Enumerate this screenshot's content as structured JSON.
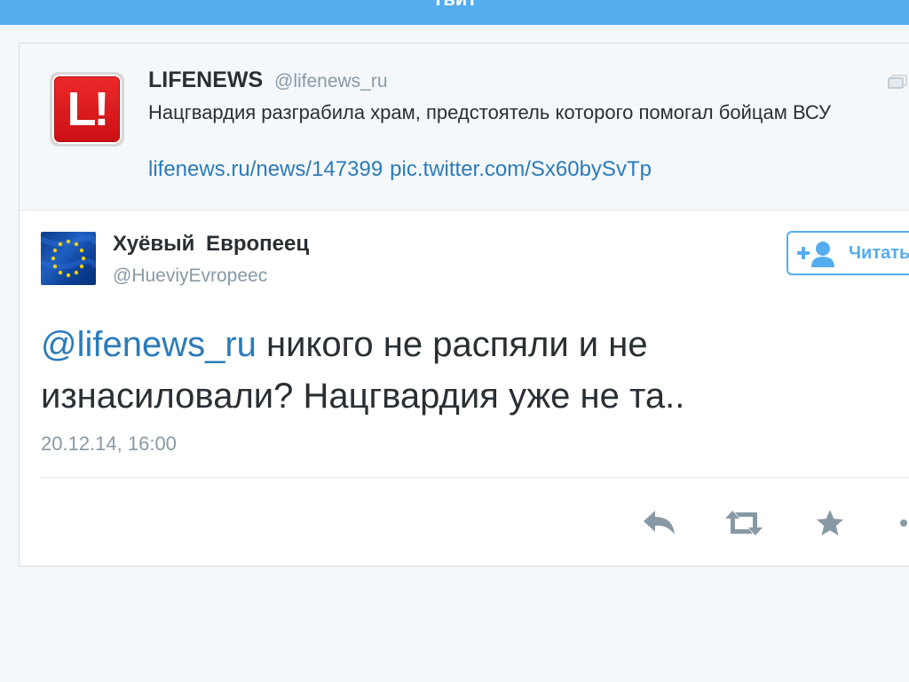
{
  "top_bar": {
    "title": "Твит"
  },
  "quoted_tweet": {
    "logo_text": "L!",
    "author_name": "LIFENEWS",
    "author_handle": "@lifenews_ru",
    "text": "Нацгвардия разграбила храм, предстоятель которого помогал бойцам ВСУ",
    "link": "lifenews.ru/news/147399",
    "media_link": "pic.twitter.com/Sx60bySvTp",
    "icon": "gallery-icon"
  },
  "tweet": {
    "author_name": "Хуёвый Европеец",
    "author_handle": "@HueviyEvropeec",
    "avatar": "eu-flag-avatar",
    "follow_label": "Читать",
    "mention": "@lifenews_ru",
    "text": " никого не распяли и не изнасиловали? Нацгвардия уже не та..",
    "timestamp": "20.12.14, 16:00"
  },
  "actions": [
    "reply-icon",
    "retweet-icon",
    "favorite-icon",
    "more-icon"
  ],
  "colors": {
    "accent": "#55acee",
    "link": "#2b7bb9",
    "text": "#292f33",
    "muted": "#8899a6",
    "logo_red": "#e21f23"
  }
}
